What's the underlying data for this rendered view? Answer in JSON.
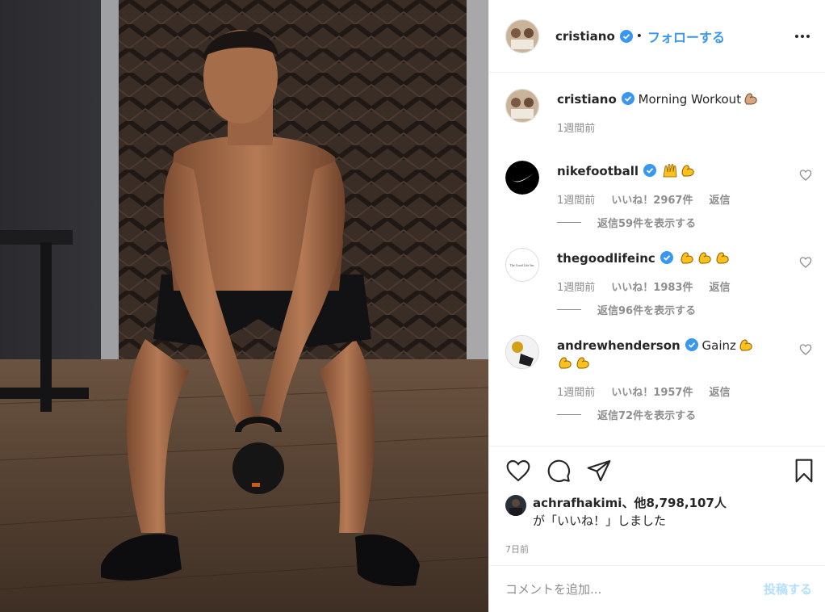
{
  "post": {
    "username": "cristiano",
    "follow_label": "フォローする",
    "separator": "•"
  },
  "caption": {
    "username": "cristiano",
    "text": "Morning Workout",
    "emoji": "flexed-biceps",
    "time": "1週間前"
  },
  "comments": [
    {
      "username": "nikefootball",
      "text": "",
      "emojis": [
        "raising-hands",
        "flexed-biceps"
      ],
      "time": "1週間前",
      "likes": "いいね！2967件",
      "reply_label": "返信",
      "view_replies": "返信59件を表示する"
    },
    {
      "username": "thegoodlifeinc",
      "text": "",
      "emojis": [
        "flexed-biceps",
        "flexed-biceps",
        "flexed-biceps"
      ],
      "time": "1週間前",
      "likes": "いいね！1983件",
      "reply_label": "返信",
      "view_replies": "返信96件を表示する"
    },
    {
      "username": "andrewhenderson",
      "text": "Gainz",
      "emojis": [
        "flexed-biceps",
        "flexed-biceps",
        "flexed-biceps"
      ],
      "time": "1週間前",
      "likes": "いいね！1957件",
      "reply_label": "返信",
      "view_replies": "返信72件を表示する"
    }
  ],
  "likes_summary": {
    "user": "achrafhakimi",
    "text_mid": "、他8,798,107人",
    "text_end": "が「いいね！」しました"
  },
  "date": "7日前",
  "add_comment": {
    "placeholder": "コメントを追加...",
    "post_label": "投稿する"
  },
  "colors": {
    "link_blue": "#3897f0",
    "disabled_blue": "#b2dffc",
    "verified": "#3897f0",
    "muted": "#8e8e8e"
  }
}
